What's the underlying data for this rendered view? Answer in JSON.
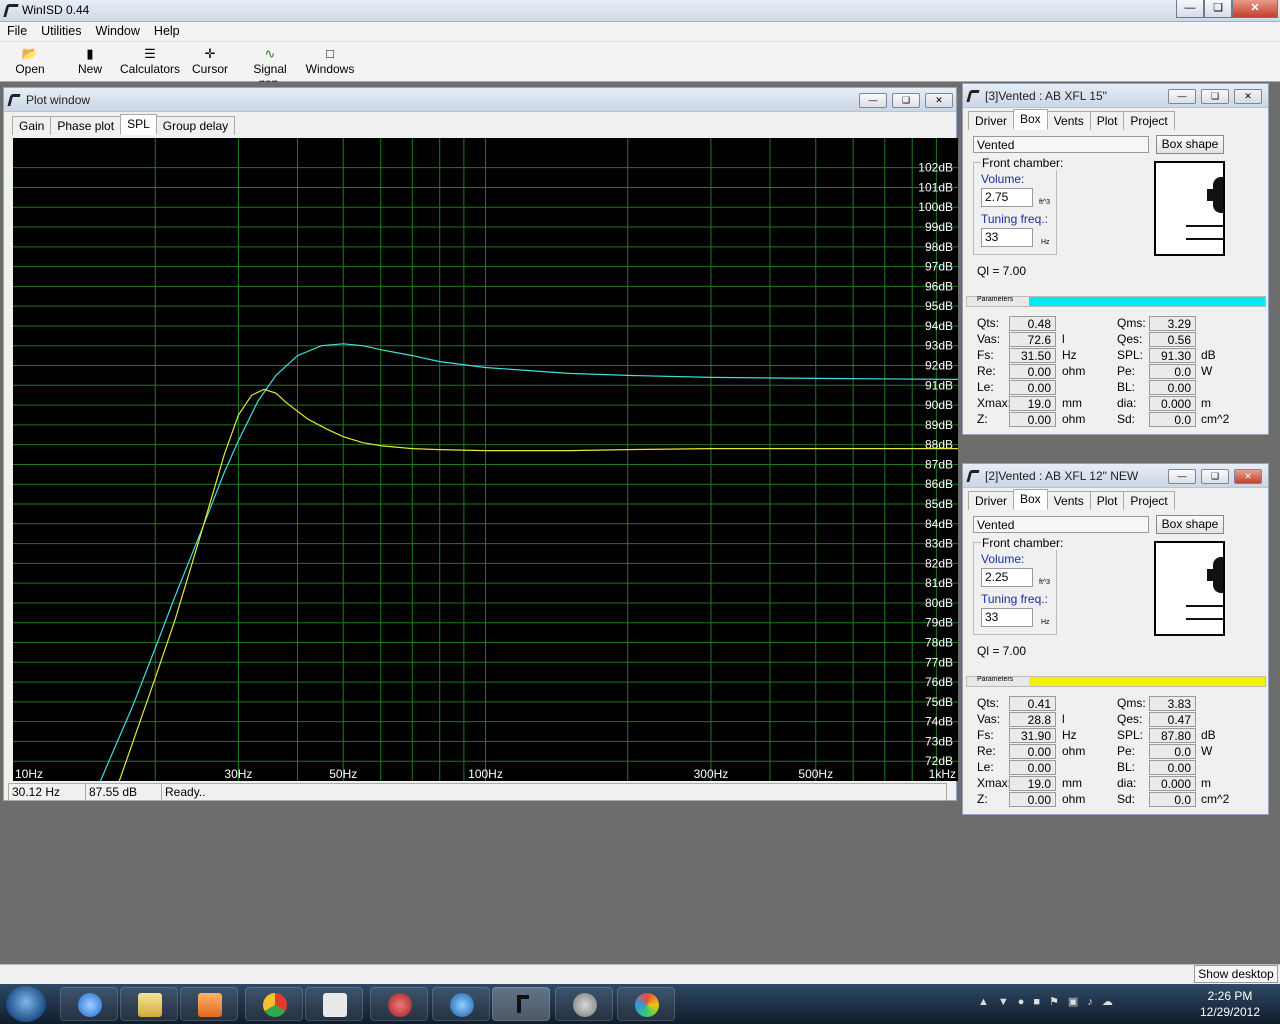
{
  "app": {
    "title": "WinISD 0.44"
  },
  "menu": [
    "File",
    "Utilities",
    "Window",
    "Help"
  ],
  "toolbar": [
    {
      "label": "Open",
      "icon": "folder-open-icon"
    },
    {
      "label": "New",
      "icon": "new-document-icon"
    },
    {
      "label": "Calculators",
      "icon": "calculator-icon"
    },
    {
      "label": "Cursor",
      "icon": "crosshair-icon"
    },
    {
      "label": "Signal gen.",
      "icon": "signal-generator-icon"
    },
    {
      "label": "Windows",
      "icon": "windows-icon"
    }
  ],
  "plot_window": {
    "title": "Plot window",
    "tabs": [
      "Gain",
      "Phase plot",
      "SPL",
      "Group delay"
    ],
    "selected_tab": "SPL",
    "status": {
      "freq": "30.12 Hz",
      "level": "87.55 dB",
      "message": "Ready.."
    }
  },
  "chart_data": {
    "type": "line",
    "x_scale": "log",
    "xlim": [
      10,
      1000
    ],
    "ylim": [
      71,
      103.5
    ],
    "x_tick_labels": [
      {
        "v": 10,
        "t": "10Hz"
      },
      {
        "v": 30,
        "t": "30Hz"
      },
      {
        "v": 50,
        "t": "50Hz"
      },
      {
        "v": 100,
        "t": "100Hz"
      },
      {
        "v": 300,
        "t": "300Hz"
      },
      {
        "v": 500,
        "t": "500Hz"
      },
      {
        "v": 1000,
        "t": "1kHz"
      }
    ],
    "x_grid": [
      20,
      30,
      40,
      50,
      60,
      70,
      80,
      90,
      100,
      200,
      300,
      400,
      500,
      600,
      700,
      800,
      900
    ],
    "y_ticks": [
      72,
      73,
      74,
      75,
      76,
      77,
      78,
      79,
      80,
      81,
      82,
      83,
      84,
      85,
      86,
      87,
      88,
      89,
      90,
      91,
      92,
      93,
      94,
      95,
      96,
      97,
      98,
      99,
      100,
      101,
      102
    ],
    "y_tick_suffix": "dB",
    "grid": true,
    "background": "#000000",
    "grid_color": "#1f7a1f",
    "series": [
      {
        "color": "#3fe0e0",
        "x": [
          15,
          18,
          20,
          22,
          25,
          28,
          30,
          33,
          36,
          40,
          45,
          50,
          55,
          60,
          70,
          80,
          100,
          150,
          200,
          300,
          500,
          1000
        ],
        "y": [
          70.5,
          74.9,
          77.7,
          80.3,
          83.6,
          86.6,
          88.2,
          90.2,
          91.5,
          92.5,
          93.0,
          93.1,
          93.0,
          92.8,
          92.5,
          92.2,
          91.9,
          91.6,
          91.5,
          91.4,
          91.35,
          91.3
        ]
      },
      {
        "color": "#e6e63a",
        "x": [
          16.5,
          20,
          22,
          25,
          28,
          30,
          32,
          34,
          36,
          38,
          42,
          46,
          50,
          55,
          60,
          70,
          80,
          100,
          150,
          200,
          300,
          500,
          1000
        ],
        "y": [
          70.5,
          76.2,
          79.1,
          83.5,
          87.5,
          89.5,
          90.5,
          90.8,
          90.6,
          90.1,
          89.3,
          88.8,
          88.4,
          88.1,
          87.95,
          87.8,
          87.75,
          87.7,
          87.7,
          87.75,
          87.8,
          87.8,
          87.8
        ]
      }
    ]
  },
  "boxes": [
    {
      "title": "[3]Vented : AB XFL 15\"",
      "tabs": [
        "Driver",
        "Box",
        "Vents",
        "Plot",
        "Project"
      ],
      "box_type": "Vented",
      "box_shape_btn": "Box shape",
      "front_chamber": "Front chamber:",
      "volume_label": "Volume:",
      "volume": "2.75",
      "volume_unit": "ft^3",
      "tuning_label": "Tuning freq.:",
      "tuning": "33",
      "tuning_unit": "Hz",
      "ql": "Ql = 7.00",
      "params_label": "Parameters",
      "color": "#00e8f0",
      "params_left": [
        {
          "k": "Qts:",
          "v": "0.48",
          "u": ""
        },
        {
          "k": "Vas:",
          "v": "72.6",
          "u": "l"
        },
        {
          "k": "Fs:",
          "v": "31.50",
          "u": "Hz"
        },
        {
          "k": "Re:",
          "v": "0.00",
          "u": "ohm"
        },
        {
          "k": "Le:",
          "v": "0.00",
          "u": ""
        },
        {
          "k": "Xmax:",
          "v": "19.0",
          "u": "mm"
        },
        {
          "k": "Z:",
          "v": "0.00",
          "u": "ohm"
        }
      ],
      "params_right": [
        {
          "k": "Qms:",
          "v": "3.29",
          "u": ""
        },
        {
          "k": "Qes:",
          "v": "0.56",
          "u": ""
        },
        {
          "k": "SPL:",
          "v": "91.30",
          "u": "dB"
        },
        {
          "k": "Pe:",
          "v": "0.0",
          "u": "W"
        },
        {
          "k": "BL:",
          "v": "0.00",
          "u": ""
        },
        {
          "k": "dia:",
          "v": "0.000",
          "u": "m"
        },
        {
          "k": "Sd:",
          "v": "0.0",
          "u": "cm^2"
        }
      ]
    },
    {
      "title": "[2]Vented : AB XFL 12\" NEW",
      "tabs": [
        "Driver",
        "Box",
        "Vents",
        "Plot",
        "Project"
      ],
      "box_type": "Vented",
      "box_shape_btn": "Box shape",
      "front_chamber": "Front chamber:",
      "volume_label": "Volume:",
      "volume": "2.25",
      "volume_unit": "ft^3",
      "tuning_label": "Tuning freq.:",
      "tuning": "33",
      "tuning_unit": "Hz",
      "ql": "Ql = 7.00",
      "params_label": "Parameters",
      "color": "#f2f200",
      "params_left": [
        {
          "k": "Qts:",
          "v": "0.41",
          "u": ""
        },
        {
          "k": "Vas:",
          "v": "28.8",
          "u": "l"
        },
        {
          "k": "Fs:",
          "v": "31.90",
          "u": "Hz"
        },
        {
          "k": "Re:",
          "v": "0.00",
          "u": "ohm"
        },
        {
          "k": "Le:",
          "v": "0.00",
          "u": ""
        },
        {
          "k": "Xmax:",
          "v": "19.0",
          "u": "mm"
        },
        {
          "k": "Z:",
          "v": "0.00",
          "u": "ohm"
        }
      ],
      "params_right": [
        {
          "k": "Qms:",
          "v": "3.83",
          "u": ""
        },
        {
          "k": "Qes:",
          "v": "0.47",
          "u": ""
        },
        {
          "k": "SPL:",
          "v": "87.80",
          "u": "dB"
        },
        {
          "k": "Pe:",
          "v": "0.0",
          "u": "W"
        },
        {
          "k": "BL:",
          "v": "0.00",
          "u": ""
        },
        {
          "k": "dia:",
          "v": "0.000",
          "u": "m"
        },
        {
          "k": "Sd:",
          "v": "0.0",
          "u": "cm^2"
        }
      ]
    }
  ],
  "desktop": {
    "show_desktop": "Show desktop"
  },
  "taskbar": {
    "time": "2:26 PM",
    "date": "12/29/2012",
    "apps": [
      "start-orb-icon",
      "internet-explorer-icon",
      "file-explorer-icon",
      "media-player-icon",
      "chrome-icon",
      "app-icon",
      "app-icon",
      "itunes-icon",
      "winisd-icon",
      "speaker-icon",
      "paint-icon"
    ]
  }
}
